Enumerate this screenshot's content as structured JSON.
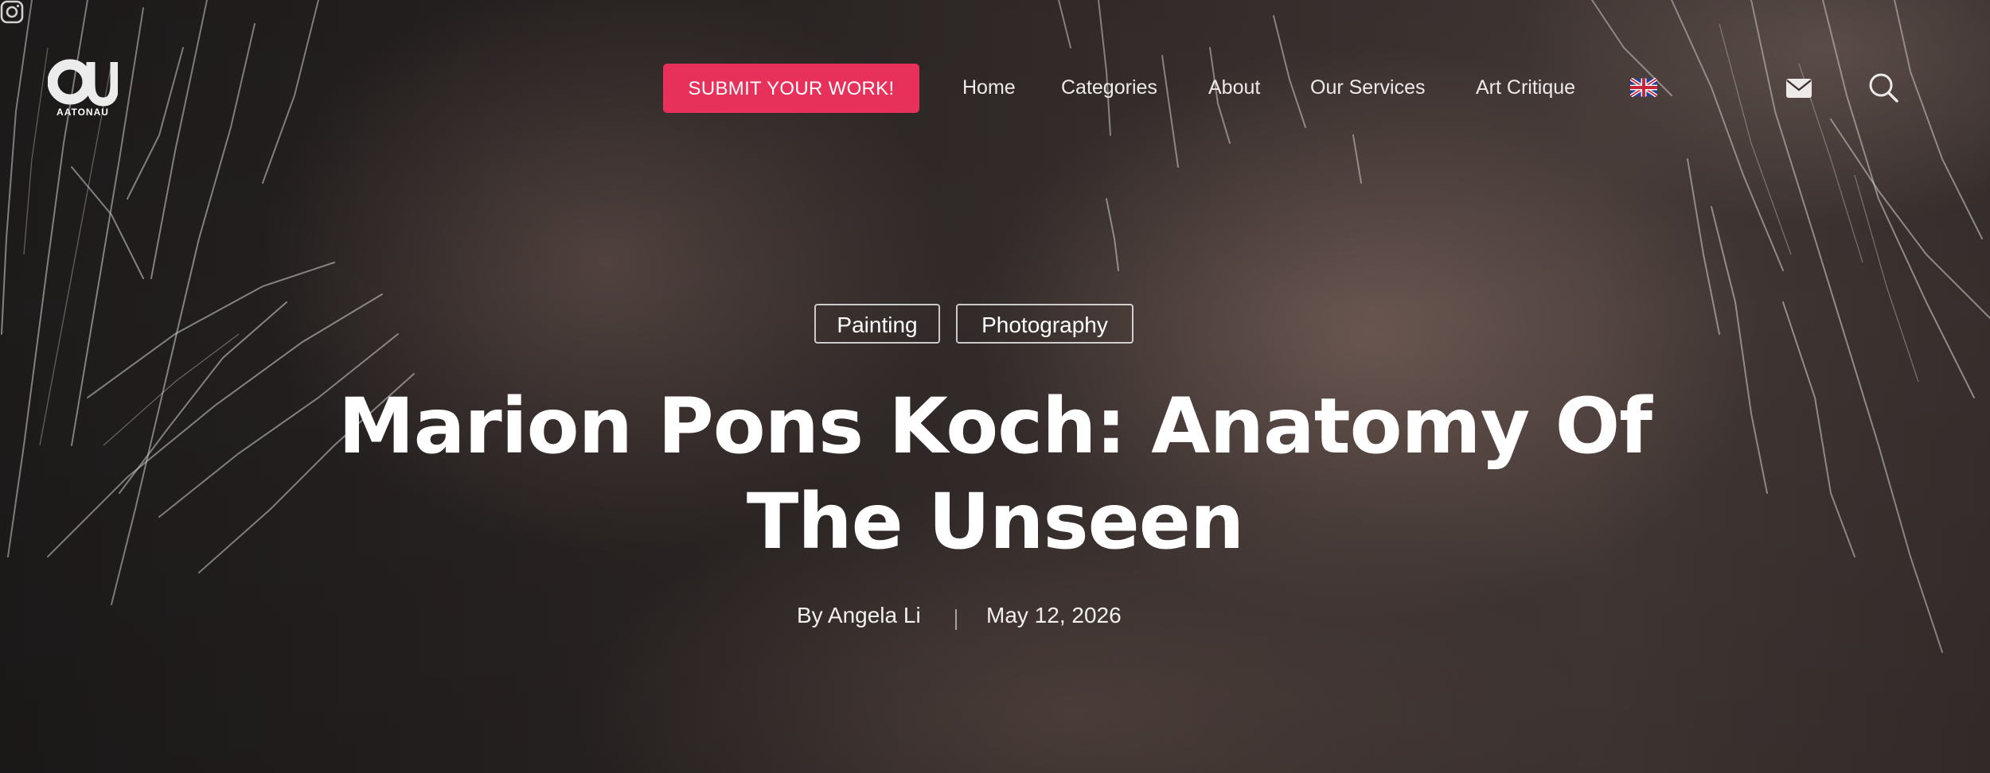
{
  "site": {
    "logo_text": "AATONAU"
  },
  "header": {
    "submit_label": "SUBMIT YOUR WORK!",
    "nav": [
      "Home",
      "Categories",
      "About",
      "Our Services",
      "Art Critique"
    ],
    "language_flag": "uk-flag-icon",
    "icons": [
      "instagram-icon",
      "mail-icon",
      "search-icon"
    ],
    "accent_color": "#e8315a"
  },
  "article": {
    "tags": [
      "Painting",
      "Photography"
    ],
    "title_line1": "Marion Pons Koch: Anatomy Of",
    "title_line2": "The Unseen",
    "author": "By Angela Li",
    "date": "May 12, 2026"
  }
}
